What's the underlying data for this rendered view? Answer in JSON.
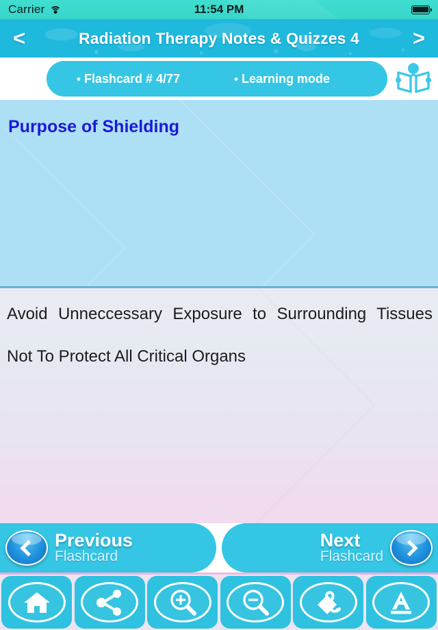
{
  "status_bar": {
    "carrier": "Carrier",
    "wifi_icon": "wifi-icon",
    "time": "11:54 PM",
    "battery_icon": "battery-full-icon"
  },
  "header": {
    "back_label": "<",
    "forward_label": ">",
    "title": "Radiation Therapy Notes & Quizzes 4",
    "accent_color": "#1fb9dd"
  },
  "info_bar": {
    "bullet": "•",
    "flashcard_label": "Flashcard #  4/77",
    "mode_label": "Learning mode",
    "book_icon": "open-book-icon",
    "pill_color": "#34c6e4"
  },
  "card": {
    "question": "Purpose of Shielding",
    "question_color": "#1a1ad6",
    "question_bg": "#addff5",
    "answer_line_1": "Avoid Unneccessary Exposure to Surrounding Tissues",
    "answer_line_2": "Not To Protect All Critical Organs"
  },
  "navigation": {
    "previous": {
      "title": "Previous",
      "subtitle": "Flashcard",
      "icon": "chevron-left-icon"
    },
    "next": {
      "title": "Next",
      "subtitle": "Flashcard",
      "icon": "chevron-right-icon"
    }
  },
  "toolbar": {
    "items": [
      {
        "name": "home-icon",
        "label": "Home"
      },
      {
        "name": "share-icon",
        "label": "Share"
      },
      {
        "name": "zoom-in-icon",
        "label": "Zoom In"
      },
      {
        "name": "zoom-out-icon",
        "label": "Zoom Out"
      },
      {
        "name": "tag-icon",
        "label": "Tag"
      },
      {
        "name": "font-icon",
        "label": "Font"
      }
    ],
    "background_color": "#ece4f2",
    "button_color": "#2ec2e0"
  }
}
